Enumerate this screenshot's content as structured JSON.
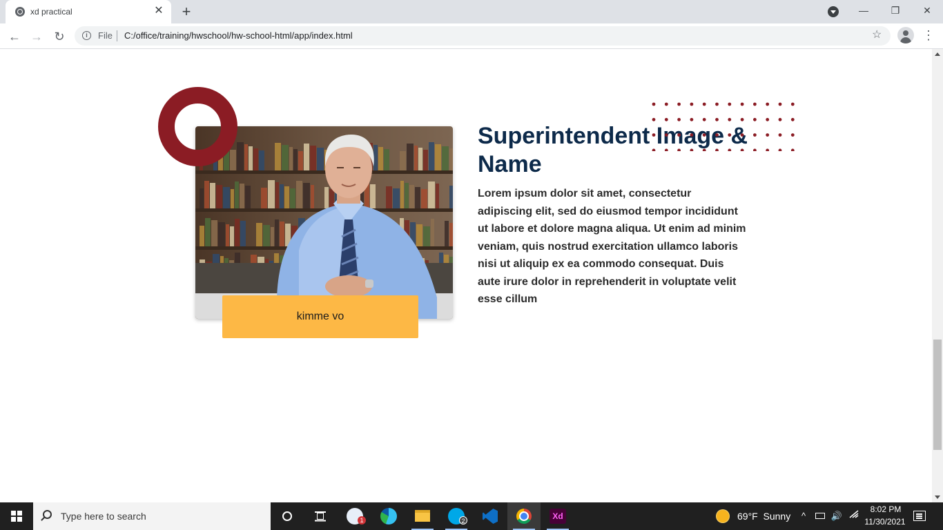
{
  "browser": {
    "tab_title": "xd practical",
    "close_glyph": "✕",
    "new_tab_glyph": "+",
    "minimize_glyph": "—",
    "restore_glyph": "❐",
    "window_close_glyph": "✕",
    "back_glyph": "←",
    "forward_glyph": "→",
    "reload_glyph": "↻",
    "info_glyph": "i",
    "url_scheme_label": "File",
    "url": "C:/office/training/hwschool/hw-school-html/app/index.html",
    "star_glyph": "☆",
    "menu_glyph": "⋮"
  },
  "page": {
    "headline": "Superintendent Image & Name",
    "bio": "Lorem ipsum dolor sit amet, consectetur adipiscing elit, sed do eiusmod tempor incididunt ut labore et dolore magna aliqua. Ut enim ad minim veniam, quis nostrud exercitation ullamco laboris nisi ut aliquip ex ea commodo consequat. Duis aute irure dolor in reprehenderit in voluptate velit esse cillum",
    "name_plate": "kimme vo",
    "colors": {
      "headline": "#0d2a4a",
      "ring": "#8b1c24",
      "dots": "#8b1c24",
      "name_plate": "#fdb845"
    }
  },
  "taskbar": {
    "search_placeholder": "Type here to search",
    "apps": [
      {
        "name": "outlook-icon",
        "badge": "1"
      },
      {
        "name": "edge-icon",
        "badge": ""
      },
      {
        "name": "file-explorer-icon",
        "badge": ""
      },
      {
        "name": "skype-icon",
        "badge": "2"
      },
      {
        "name": "vscode-icon",
        "badge": ""
      },
      {
        "name": "chrome-icon",
        "badge": ""
      },
      {
        "name": "adobe-xd-icon",
        "label": "Xd"
      }
    ],
    "weather": {
      "temperature": "69°F",
      "condition": "Sunny"
    },
    "clock": {
      "time": "8:02 PM",
      "date": "11/30/2021"
    },
    "tray_up_glyph": "^",
    "speaker_glyph": "🔊"
  }
}
